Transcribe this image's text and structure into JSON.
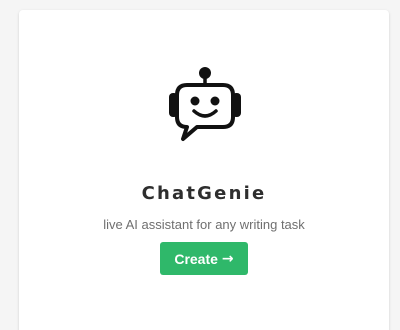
{
  "card": {
    "logo_icon": "chat-robot-icon",
    "title": "ChatGenie",
    "subtitle": "live AI assistant for any writing task",
    "create_button": {
      "label": "Create",
      "icon": "arrow-right-icon",
      "icon_glyph": "→",
      "color": "#2fb86a"
    }
  }
}
